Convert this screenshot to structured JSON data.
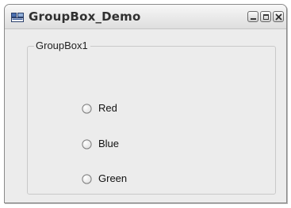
{
  "window": {
    "title": "GroupBox_Demo",
    "icon": "window-app-icon",
    "controls": {
      "minimize": "minimize-icon",
      "maximize": "maximize-icon",
      "close": "close-icon"
    }
  },
  "groupbox": {
    "label": "GroupBox1",
    "options": [
      {
        "label": "Red",
        "checked": false
      },
      {
        "label": "Blue",
        "checked": false
      },
      {
        "label": "Green",
        "checked": false
      }
    ]
  },
  "colors": {
    "window_bg": "#ececec",
    "title_text": "#303030",
    "group_border": "#c9c9c9"
  }
}
